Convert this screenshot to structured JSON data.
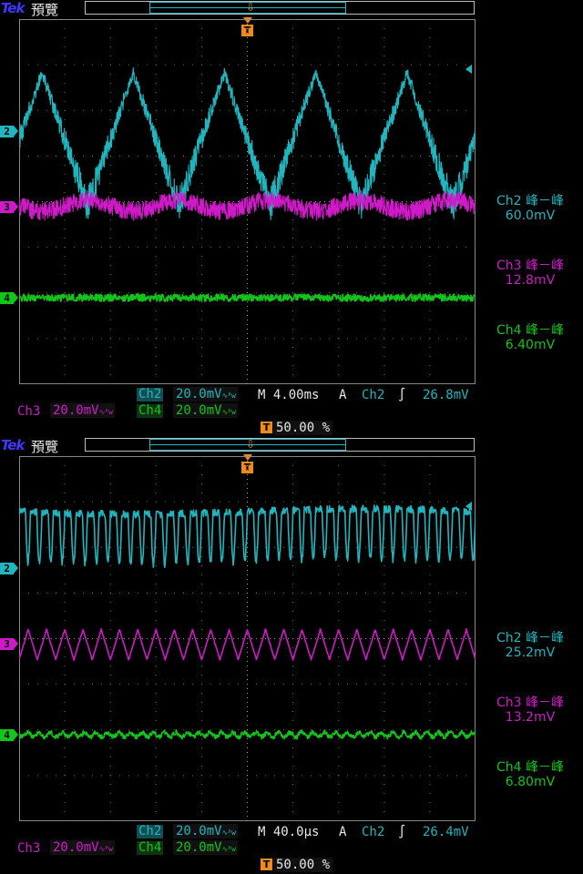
{
  "header": {
    "logo": "Tek",
    "mode": "預覽"
  },
  "colors": {
    "ch2": "#21b6bf",
    "ch3": "#d01ac9",
    "ch4": "#12c519",
    "trigger": "#f08a1c",
    "grid": "#6a6a6a"
  },
  "panels": [
    {
      "measurements": [
        {
          "label": "Ch2 峰－峰",
          "value": "60.0mV"
        },
        {
          "label": "Ch3 峰－峰",
          "value": "12.8mV"
        },
        {
          "label": "Ch4 峰－峰",
          "value": "6.40mV"
        }
      ],
      "status": {
        "ch2_label": "Ch2",
        "ch2_scale": "20.0mV",
        "ch3_label": "Ch3",
        "ch3_scale": "20.0mV",
        "ch4_label": "Ch4",
        "ch4_scale": "20.0mV",
        "timebase": "M 4.00ms",
        "trigger_mode": "A",
        "trigger_source": "Ch2",
        "trigger_slope": "∫",
        "trigger_level": "26.8mV",
        "trigger_position": "50.00 %",
        "bw_suffix": "ᴮw"
      },
      "markers": {
        "ch2": "2",
        "ch3": "3",
        "ch4": "4",
        "t": "T"
      }
    },
    {
      "measurements": [
        {
          "label": "Ch2 峰－峰",
          "value": "25.2mV"
        },
        {
          "label": "Ch3 峰－峰",
          "value": "13.2mV"
        },
        {
          "label": "Ch4 峰－峰",
          "value": "6.80mV"
        }
      ],
      "status": {
        "ch2_label": "Ch2",
        "ch2_scale": "20.0mV",
        "ch3_label": "Ch3",
        "ch3_scale": "20.0mV",
        "ch4_label": "Ch4",
        "ch4_scale": "20.0mV",
        "timebase": "M 40.0µs",
        "trigger_mode": "A",
        "trigger_source": "Ch2",
        "trigger_slope": "∫",
        "trigger_level": "26.4mV",
        "trigger_position": "50.00 %",
        "bw_suffix": "ᴮw"
      },
      "markers": {
        "ch2": "2",
        "ch3": "3",
        "ch4": "4",
        "t": "T"
      }
    }
  ],
  "chart_data": [
    {
      "type": "line",
      "x_divisions": 10,
      "y_divisions": 8,
      "series": [
        {
          "name": "Ch2",
          "cycles": 5,
          "amplitude_div": 1.45,
          "noise_div": 0.25,
          "offset_div": 0
        },
        {
          "name": "Ch3",
          "cycles": 5,
          "amplitude_div": 0.12,
          "noise_div": 0.2,
          "offset_div": 0
        },
        {
          "name": "Ch4",
          "cycles": 0,
          "amplitude_div": 0.0,
          "noise_div": 0.08,
          "offset_div": 0
        }
      ]
    },
    {
      "type": "line",
      "x_divisions": 10,
      "y_divisions": 8,
      "series": [
        {
          "name": "Ch2",
          "cycles": 40,
          "amplitude_div": 0.55,
          "noise_div": 0.08,
          "offset_div": 0
        },
        {
          "name": "Ch3",
          "cycles": 25,
          "amplitude_div": 0.33,
          "noise_div": 0.03,
          "offset_div": 0
        },
        {
          "name": "Ch4",
          "cycles": 40,
          "amplitude_div": 0.05,
          "noise_div": 0.05,
          "offset_div": 0
        }
      ]
    }
  ]
}
